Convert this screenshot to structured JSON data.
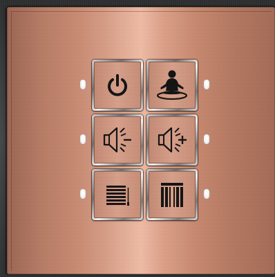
{
  "panel": {
    "finish": "brushed copper",
    "colors": {
      "copper": "#c98a72",
      "copper_highlight": "#f0bca5",
      "icon": "#151515",
      "indicator": "#ffffff"
    },
    "buttons": [
      {
        "icon": "power-icon",
        "row": 1,
        "column": 1
      },
      {
        "icon": "meditation-icon",
        "row": 1,
        "column": 2
      },
      {
        "icon": "volume-down-icon",
        "row": 2,
        "column": 1
      },
      {
        "icon": "volume-up-icon",
        "row": 2,
        "column": 2
      },
      {
        "icon": "blinds-icon",
        "row": 3,
        "column": 1
      },
      {
        "icon": "curtains-icon",
        "row": 3,
        "column": 2
      }
    ],
    "indicator_leds": 6
  }
}
